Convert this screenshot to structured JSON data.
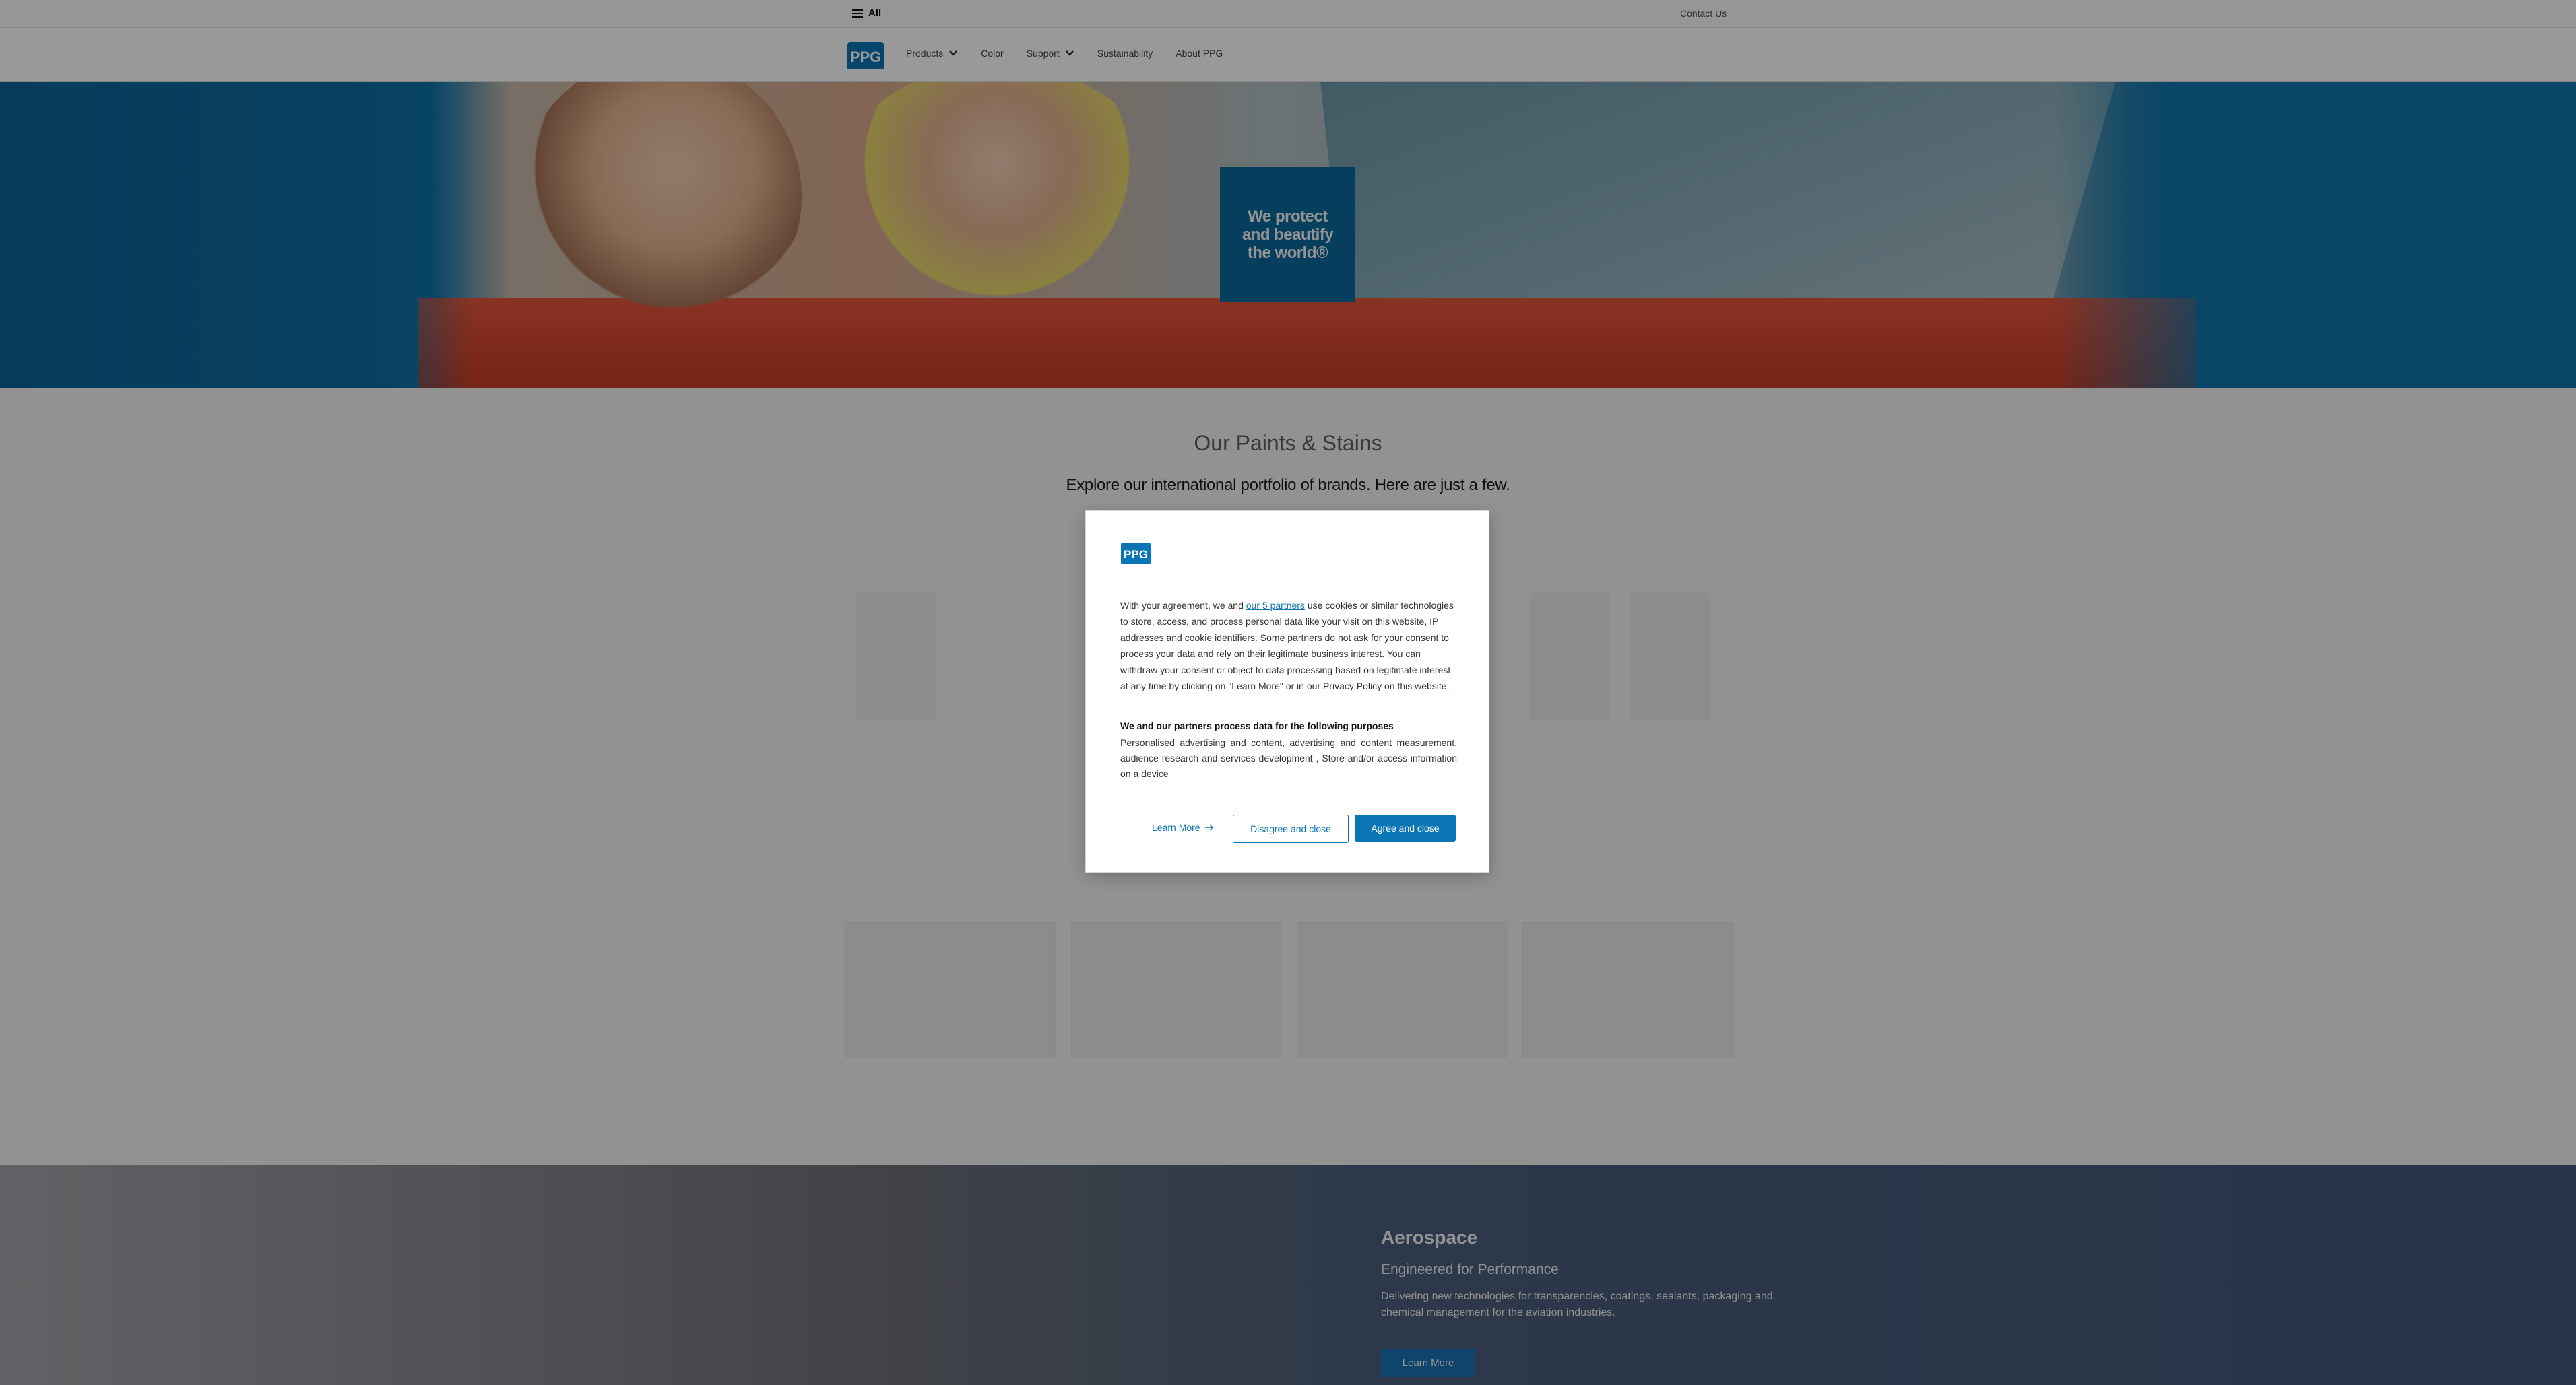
{
  "utility_bar": {
    "all_label": "All",
    "contact_label": "Contact Us"
  },
  "nav": {
    "logo_text": "PPG",
    "items": [
      {
        "label": "Products",
        "has_dropdown": true
      },
      {
        "label": "Color",
        "has_dropdown": false
      },
      {
        "label": "Support",
        "has_dropdown": true
      },
      {
        "label": "Sustainability",
        "has_dropdown": false
      },
      {
        "label": "About PPG",
        "has_dropdown": false
      }
    ]
  },
  "hero": {
    "badge_text": "We protect and beautify the world®"
  },
  "content": {
    "title": "Our Paints & Stains",
    "subtitle": "Explore our international portfolio of brands. Here are just a few."
  },
  "aerospace": {
    "heading": "Aerospace",
    "subheading": "Engineered for Performance",
    "description": "Delivering new technologies for transparencies, coatings, sealants, packaging and chemical management for the aviation industries.",
    "button_label": "Learn More"
  },
  "consent": {
    "logo_text": "PPG",
    "body_prefix": "With your agreement, we and ",
    "partners_link": "our 5 partners",
    "body_suffix": " use cookies or similar technologies to store, access, and process personal data like your visit on this website, IP addresses and cookie identifiers. Some partners do not ask for your consent to process your data and rely on their legitimate business interest. You can withdraw your consent or object to data processing based on legitimate interest at any time by clicking on \"Learn More\" or in our Privacy Policy on this website.",
    "purposes_title": "We and our partners process data for the following purposes",
    "purposes_text": "Personalised advertising and content, advertising and content measurement, audience research and services development , Store and/or access information on a device",
    "learn_more_label": "Learn More",
    "disagree_label": "Disagree and close",
    "agree_label": "Agree and close"
  },
  "colors": {
    "brand_blue": "#0b76b6",
    "hero_blue": "#0f73a8",
    "badge_blue": "#0b6a9c"
  }
}
